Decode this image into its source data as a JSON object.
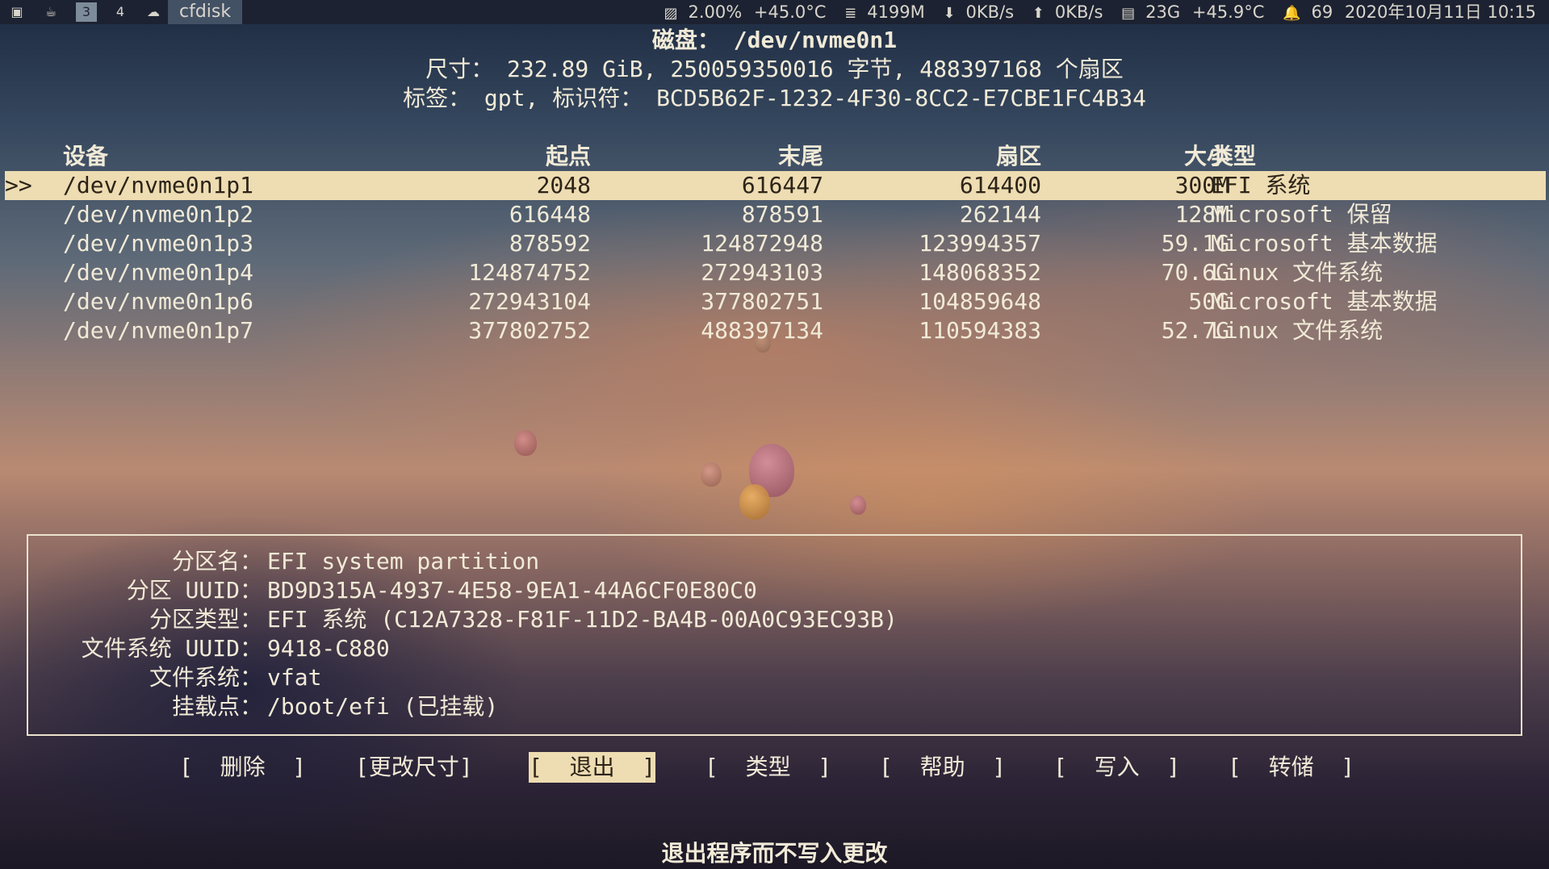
{
  "topbar": {
    "title": "cfdisk",
    "workspaces": [
      "3",
      "4"
    ],
    "status": {
      "cpu": "2.00%",
      "cpu_temp": "+45.0°C",
      "memory": "4199M",
      "download": "0KB/s",
      "upload": "0KB/s",
      "disk": "23G",
      "disk_temp": "+45.9°C",
      "notifications": "69",
      "datetime": "2020年10月11日 10:15"
    }
  },
  "disk": {
    "title": "磁盘： /dev/nvme0n1",
    "size_line": "尺寸： 232.89 GiB, 250059350016 字节, 488397168 个扇区",
    "label_line": "标签： gpt, 标识符： BCD5B62F-1232-4F30-8CC2-E7CBE1FC4B34"
  },
  "table": {
    "headers": {
      "device": "设备",
      "start": "起点",
      "end": "末尾",
      "sectors": "扇区",
      "size": "大小",
      "type": "类型"
    },
    "selection_marker": ">>",
    "rows": [
      {
        "device": "/dev/nvme0n1p1",
        "start": "2048",
        "end": "616447",
        "sectors": "614400",
        "size": "300M",
        "type": "EFI 系统"
      },
      {
        "device": "/dev/nvme0n1p2",
        "start": "616448",
        "end": "878591",
        "sectors": "262144",
        "size": "128M",
        "type": "Microsoft 保留"
      },
      {
        "device": "/dev/nvme0n1p3",
        "start": "878592",
        "end": "124872948",
        "sectors": "123994357",
        "size": "59.1G",
        "type": "Microsoft 基本数据"
      },
      {
        "device": "/dev/nvme0n1p4",
        "start": "124874752",
        "end": "272943103",
        "sectors": "148068352",
        "size": "70.6G",
        "type": "Linux 文件系统"
      },
      {
        "device": "/dev/nvme0n1p6",
        "start": "272943104",
        "end": "377802751",
        "sectors": "104859648",
        "size": "50G",
        "type": "Microsoft 基本数据"
      },
      {
        "device": "/dev/nvme0n1p7",
        "start": "377802752",
        "end": "488397134",
        "sectors": "110594383",
        "size": "52.7G",
        "type": "Linux 文件系统"
      }
    ]
  },
  "info": {
    "name_label": "分区名：",
    "name_value": "EFI system partition",
    "uuid_label": "分区 UUID：",
    "uuid_value": "BD9D315A-4937-4E58-9EA1-44A6CF0E80C0",
    "type_label": "分区类型：",
    "type_value": "EFI 系统 (C12A7328-F81F-11D2-BA4B-00A0C93EC93B)",
    "fsuuid_label": "文件系统 UUID：",
    "fsuuid_value": "9418-C880",
    "fs_label": "文件系统：",
    "fs_value": "vfat",
    "mount_label": "挂载点：",
    "mount_value": "/boot/efi (已挂载)"
  },
  "menu": {
    "delete": "[  删除  ]",
    "resize": "[更改尺寸]",
    "quit": "[  退出  ]",
    "type": "[  类型  ]",
    "help": "[  帮助  ]",
    "write": "[  写入  ]",
    "dump": "[  转储  ]"
  },
  "status_line": "退出程序而不写入更改",
  "colors": {
    "highlight": "#eedcb2",
    "text": "#f1ead7"
  }
}
